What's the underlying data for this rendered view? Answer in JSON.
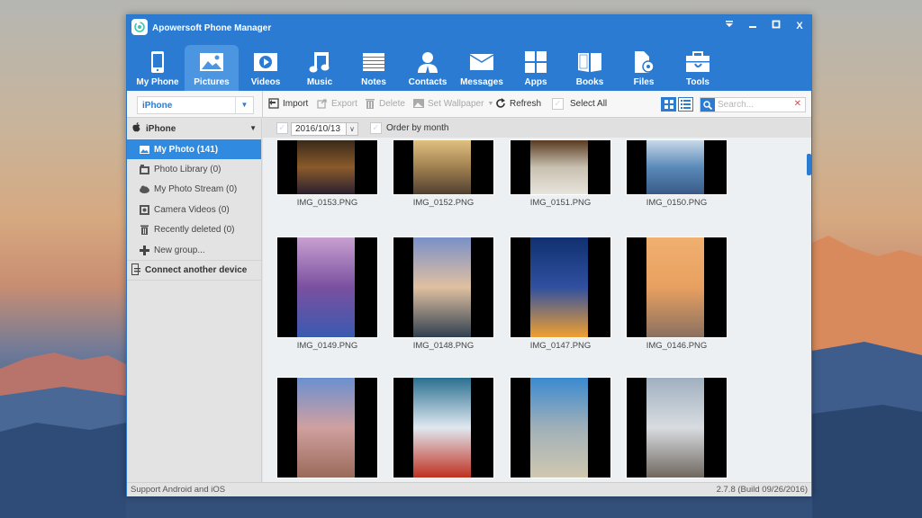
{
  "window": {
    "title": "Apowersoft Phone Manager",
    "controls": [
      {
        "name": "menu-dropdown",
        "glyph": "▾"
      },
      {
        "name": "minimize",
        "glyph": "_"
      },
      {
        "name": "maximize",
        "glyph": "☐"
      },
      {
        "name": "close",
        "glyph": "X"
      }
    ]
  },
  "nav": {
    "items": [
      {
        "label": "My Phone",
        "icon": "phone-icon",
        "active": false
      },
      {
        "label": "Pictures",
        "icon": "picture-icon",
        "active": true
      },
      {
        "label": "Videos",
        "icon": "video-play-icon",
        "active": false
      },
      {
        "label": "Music",
        "icon": "music-note-icon",
        "active": false
      },
      {
        "label": "Notes",
        "icon": "notes-icon",
        "active": false
      },
      {
        "label": "Contacts",
        "icon": "contact-person-icon",
        "active": false
      },
      {
        "label": "Messages",
        "icon": "envelope-icon",
        "active": false
      },
      {
        "label": "Apps",
        "icon": "apps-grid-icon",
        "active": false
      },
      {
        "label": "Books",
        "icon": "open-book-icon",
        "active": false
      },
      {
        "label": "Files",
        "icon": "file-gear-icon",
        "active": false
      },
      {
        "label": "Tools",
        "icon": "toolbox-icon",
        "active": false
      }
    ]
  },
  "toolbar": {
    "device_select": "iPhone",
    "import_label": "Import",
    "export_label": "Export",
    "delete_label": "Delete",
    "set_wallpaper_label": "Set Wallpaper",
    "refresh_label": "Refresh",
    "select_all_label": "Select All",
    "search_placeholder": "Search...",
    "search_value": ""
  },
  "sidebar": {
    "device_name": "iPhone",
    "items": [
      {
        "label": "My Photo (141)",
        "icon": "photo-icon",
        "active": true
      },
      {
        "label": "Photo Library (0)",
        "icon": "photo-library-icon",
        "active": false
      },
      {
        "label": "My Photo Stream (0)",
        "icon": "cloud-photo-icon",
        "active": false
      },
      {
        "label": "Camera Videos (0)",
        "icon": "camera-video-icon",
        "active": false
      },
      {
        "label": "Recently deleted (0)",
        "icon": "trash-icon",
        "active": false
      },
      {
        "label": "New group...",
        "icon": "plus-icon",
        "active": false
      }
    ],
    "connect_label": "Connect another device"
  },
  "filter": {
    "date": "2016/10/13",
    "order_by_month_label": "Order by month"
  },
  "photos": [
    {
      "name": "IMG_0153.PNG",
      "colors": [
        "#3a2a1a",
        "#8a5a2a",
        "#2a2030"
      ]
    },
    {
      "name": "IMG_0152.PNG",
      "colors": [
        "#e0c080",
        "#a08050",
        "#504030"
      ]
    },
    {
      "name": "IMG_0151.PNG",
      "colors": [
        "#5a3a20",
        "#c8c0b0",
        "#e8e4dc"
      ]
    },
    {
      "name": "IMG_0150.PNG",
      "colors": [
        "#c8d8e8",
        "#5a8ab8",
        "#3a5a88"
      ]
    },
    {
      "name": "IMG_0149.PNG",
      "colors": [
        "#c8a0d0",
        "#7a50a0",
        "#3a5ab0"
      ]
    },
    {
      "name": "IMG_0148.PNG",
      "colors": [
        "#7a90c8",
        "#e0c0a0",
        "#304050"
      ]
    },
    {
      "name": "IMG_0147.PNG",
      "colors": [
        "#103070",
        "#3050a0",
        "#f0a030"
      ]
    },
    {
      "name": "IMG_0146.PNG",
      "colors": [
        "#f0b070",
        "#e8a060",
        "#8a7060"
      ]
    },
    {
      "name": "",
      "colors": [
        "#6a90d0",
        "#d0a0a0",
        "#9a6a5a"
      ]
    },
    {
      "name": "",
      "colors": [
        "#2a7090",
        "#e0e8f0",
        "#c03020"
      ]
    },
    {
      "name": "",
      "colors": [
        "#3a8ad0",
        "#a0b0b8",
        "#d0c8b0"
      ]
    },
    {
      "name": "",
      "colors": [
        "#a0b0c0",
        "#d8dce0",
        "#706860"
      ]
    }
  ],
  "status": {
    "left": "Support Android and iOS",
    "right": "2.7.8 (Build 09/26/2016)"
  }
}
